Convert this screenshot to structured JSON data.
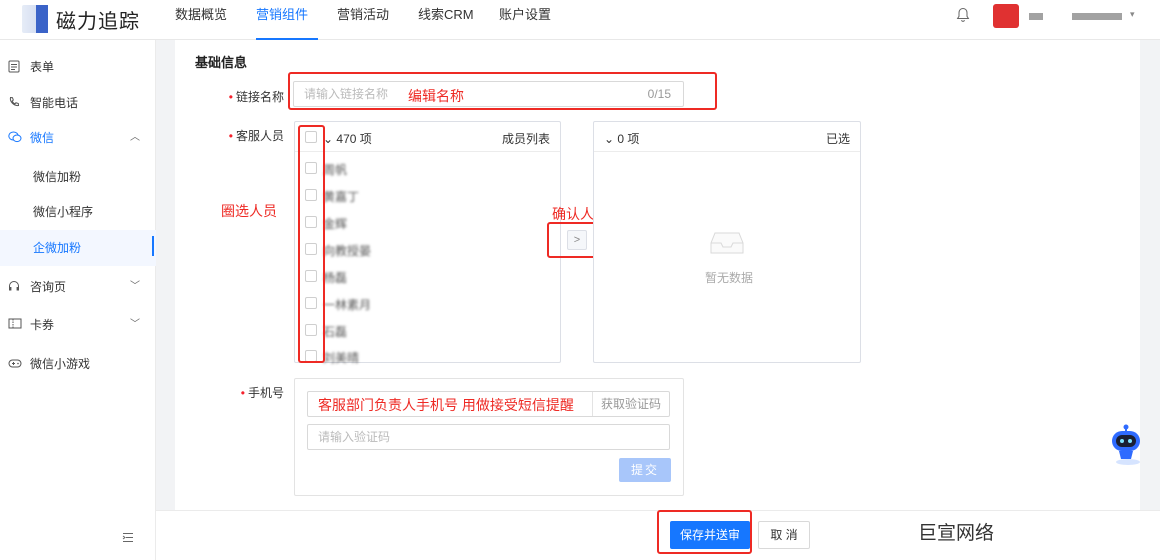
{
  "header": {
    "logo_text": "磁力追踪",
    "nav": [
      "数据概览",
      "营销组件",
      "营销活动",
      "线索CRM",
      "账户设置"
    ],
    "active_nav": "营销组件",
    "icons": [
      "bell-icon",
      "user-avatar",
      "chevron-down-icon"
    ]
  },
  "sidebar": {
    "items": [
      {
        "label": "表单",
        "icon": "form-icon"
      },
      {
        "label": "智能电话",
        "icon": "phone-icon"
      },
      {
        "label": "微信",
        "icon": "wechat-icon",
        "expanded": true
      },
      {
        "label": "微信加粉"
      },
      {
        "label": "微信小程序"
      },
      {
        "label": "企微加粉",
        "active": true
      },
      {
        "label": "咨询页",
        "icon": "headset-icon"
      },
      {
        "label": "卡券",
        "icon": "ticket-icon"
      },
      {
        "label": "微信小游戏",
        "icon": "gamepad-icon"
      }
    ],
    "collapse_icon": "collapse-menu-icon"
  },
  "form": {
    "section_title": "基础信息",
    "link_name": {
      "label": "链接名称",
      "placeholder": "请输入链接名称",
      "counter": "0/15",
      "annotation": "编辑名称"
    },
    "service_staff": {
      "label": "客服人员",
      "annotation_select": "圈选人员",
      "annotation_confirm": "确认人员",
      "source": {
        "count": "470 项",
        "title": "成员列表",
        "members": [
          "周帆",
          "黄嘉丁",
          "金辉",
          "向教授晏",
          "杨磊",
          "一林素月",
          "石磊",
          "刘美晴"
        ]
      },
      "target": {
        "count": "0 项",
        "title": "已选",
        "empty": "暂无数据"
      }
    },
    "phone": {
      "label": "手机号",
      "annotation": "客服部门负责人手机号 用做接受短信提醒",
      "get_code": "获取验证码",
      "code_placeholder": "请输入验证码",
      "submit": "提交"
    }
  },
  "footer": {
    "save_label": "保存并送审",
    "cancel_label": "取 消",
    "watermark": "巨宣网络"
  },
  "colors": {
    "primary": "#1677ff",
    "annotation_red": "#ee2a24"
  }
}
